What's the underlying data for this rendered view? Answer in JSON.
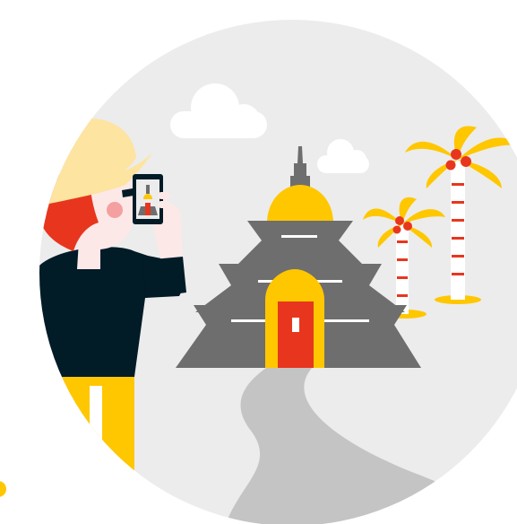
{
  "illustration": {
    "subject": "tourist-photographing-temple",
    "icons": [
      "sun-hat-icon",
      "smartphone-icon",
      "temple-icon",
      "palm-tree-icon",
      "cloud-icon",
      "path-icon"
    ]
  },
  "colors": {
    "background_circle": "#ececec",
    "cloud": "#ffffff",
    "temple_gray": "#6e6e6e",
    "temple_dome": "#ffc700",
    "temple_door": "#e8361e",
    "path": "#c4c4c4",
    "palm_leaves": "#ffc700",
    "palm_trunk": "#ffffff",
    "palm_stripes": "#e8361e",
    "coconut": "#e8361e",
    "hat": "#fde4a0",
    "hair": "#e8361e",
    "skin": "#fde8e8",
    "shirt": "#011b27",
    "pants": "#ffc700",
    "phone_frame": "#011b27"
  }
}
